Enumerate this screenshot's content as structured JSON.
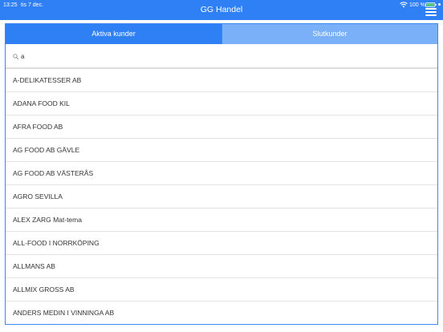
{
  "status_bar": {
    "time": "13:25",
    "date": "tis 7 dec.",
    "battery_percent": "100 %",
    "icons": [
      "wifi-icon",
      "battery-icon"
    ]
  },
  "header": {
    "title": "GG Handel",
    "menu_icon": "hamburger-menu-icon"
  },
  "tabs": [
    {
      "label": "Aktiva kunder",
      "active": true
    },
    {
      "label": "Slutkunder",
      "active": false
    }
  ],
  "search": {
    "value": "a",
    "icon": "search-icon"
  },
  "customers": [
    "A-DELIKATESSER AB",
    "ADANA FOOD KIL",
    "AFRA FOOD AB",
    "AG FOOD AB GÄVLE",
    "AG FOOD AB VÄSTERÅS",
    "AGRO SEVILLA",
    "ALEX ZARG Mat-tema",
    "ALL-FOOD I NORRKÖPING",
    "ALLMANS AB",
    "ALLMIX GROSS AB",
    "ANDERS MEDIN I VINNINGA AB"
  ],
  "colors": {
    "accent": "#2f80f5",
    "tab_inactive": "#7ab0f7",
    "text": "#333333",
    "divider": "#e3e3e3"
  }
}
